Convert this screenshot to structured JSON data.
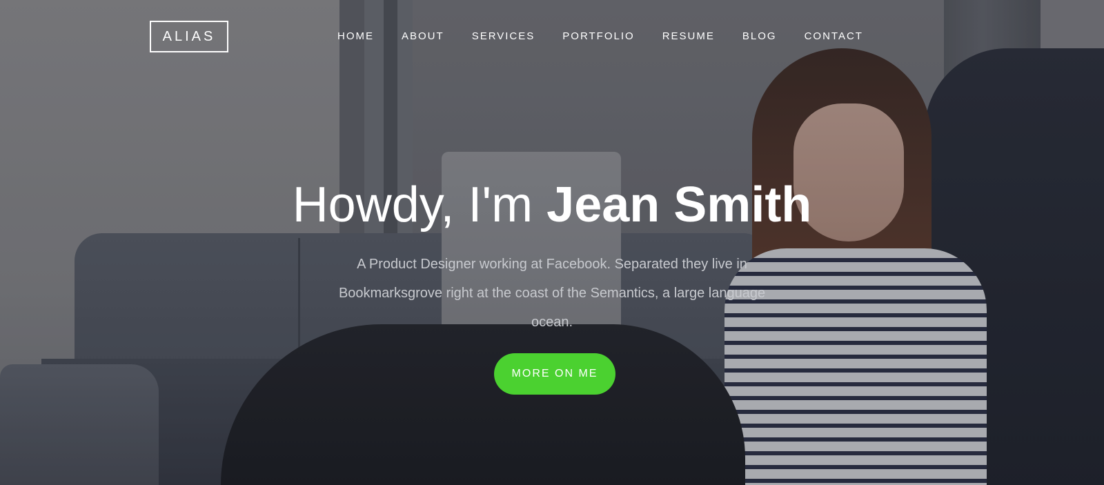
{
  "header": {
    "logo_text": "ALIAS",
    "nav": [
      {
        "label": "HOME"
      },
      {
        "label": "ABOUT"
      },
      {
        "label": "SERVICES"
      },
      {
        "label": "PORTFOLIO"
      },
      {
        "label": "RESUME"
      },
      {
        "label": "BLOG"
      },
      {
        "label": "CONTACT"
      }
    ]
  },
  "hero": {
    "greeting": "Howdy, I'm ",
    "name": "Jean Smith",
    "intro": "A Product Designer working at Facebook. Separated they live in Bookmarksgrove right at the coast of the Semantics, a large language ocean.",
    "cta_label": "MORE ON ME"
  },
  "colors": {
    "accent": "#4bd130",
    "text": "#ffffff",
    "muted_text": "#c8cacf"
  }
}
